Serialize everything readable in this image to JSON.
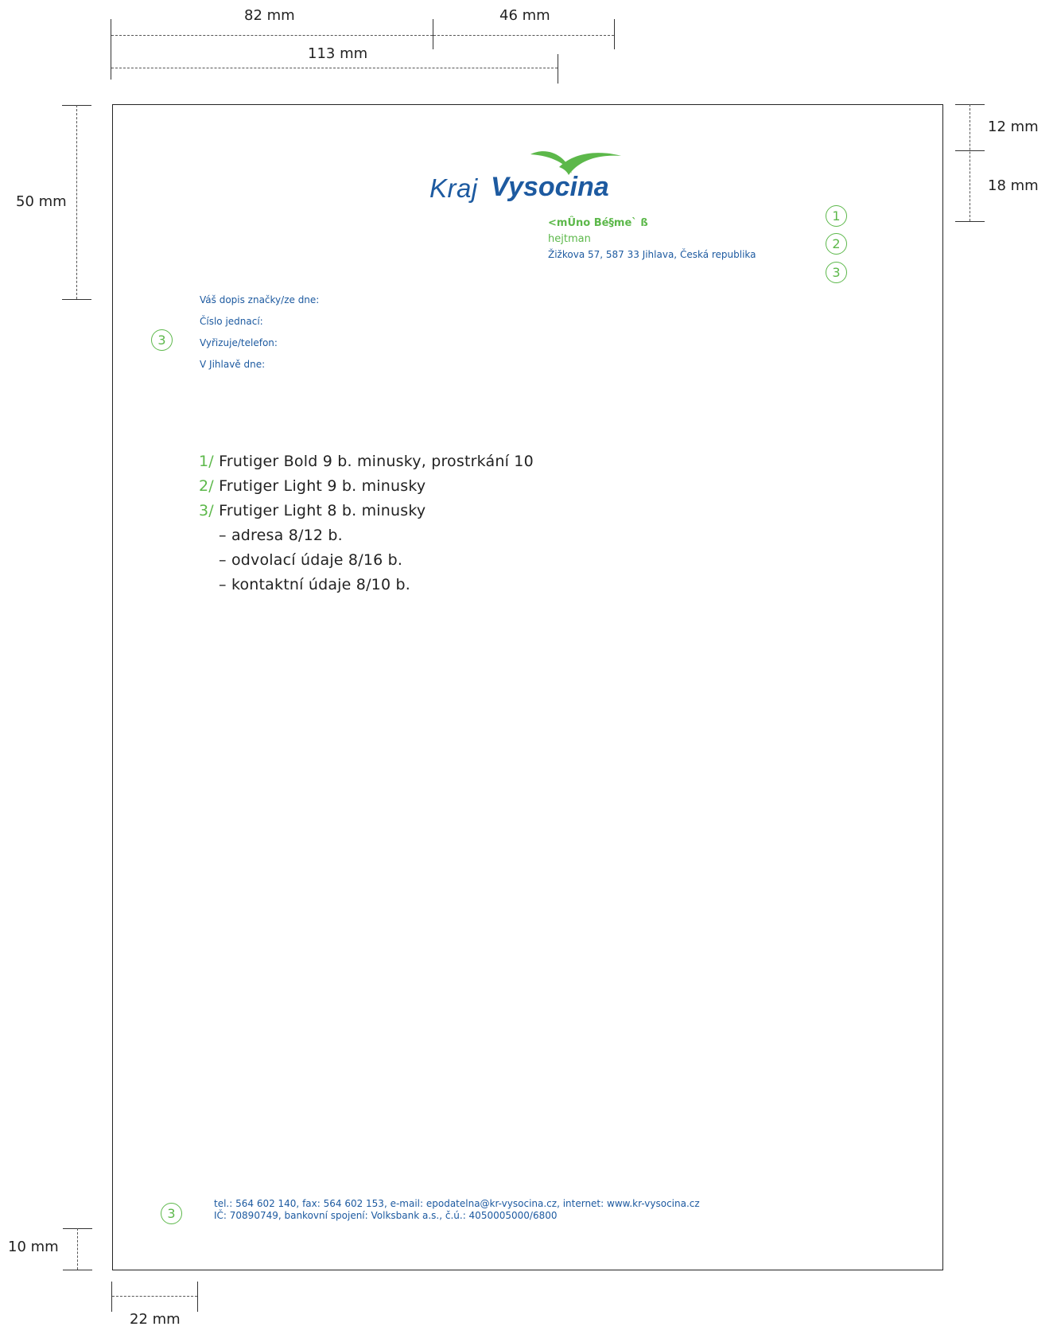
{
  "dimensions": {
    "top_82": "82 mm",
    "top_46": "46 mm",
    "top_113": "113 mm",
    "left_50": "50 mm",
    "right_12": "12 mm",
    "right_18": "18 mm",
    "bottom_left_10": "10 mm",
    "bottom_22": "22 mm"
  },
  "logo": {
    "word1": "Kraj",
    "word2": "Vysocina"
  },
  "sender": {
    "name": "<mÛno Bé§me` ß",
    "title": "hejtman",
    "address": "Žižkova 57, 587 33 Jihlava, Česká republika"
  },
  "markers": {
    "m1": "1",
    "m2": "2",
    "m3": "3"
  },
  "reference_fields": [
    "Váš dopis značky/ze dne:",
    "Číslo jednací:",
    "Vyřizuje/telefon:",
    "V Jihlavě dne:"
  ],
  "specs": [
    {
      "num": "1/",
      "text": "Frutiger Bold 9 b. minusky, prostrkání 10"
    },
    {
      "num": "2/",
      "text": "Frutiger Light 9 b. minusky"
    },
    {
      "num": "3/",
      "text": "Frutiger Light 8 b. minusky"
    }
  ],
  "spec_subitems": [
    "– adresa 8/12 b.",
    "– odvolací údaje 8/16 b.",
    "– kontaktní údaje 8/10 b."
  ],
  "footer": {
    "line1": "tel.: 564 602 140, fax: 564 602 153, e-mail: epodatelna@kr-vysocina.cz, internet: www.kr-vysocina.cz",
    "line2": "IČ: 70890749, bankovní spojení: Volksbank a.s., č.ú.: 4050005000/6800"
  },
  "colors": {
    "brand_blue": "#1d5aa0",
    "brand_green": "#5cb84a"
  }
}
